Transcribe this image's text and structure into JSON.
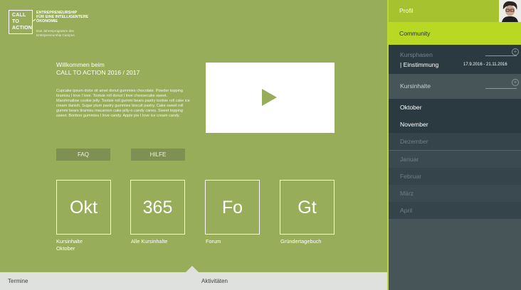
{
  "brand": {
    "logo_line1": "CALL",
    "logo_line2": "TO",
    "logo_line3": "ACTION",
    "tagline_line1": "ENTREPRENEURSHIP",
    "tagline_line2": "FÜR EINE INTELLIGENTERE",
    "tagline_line3": "ÖKONOMIE",
    "subline_line1": "Das Jahresprogramm des",
    "subline_line2": "Entrepreneurship Campus"
  },
  "main": {
    "welcome_line1": "Willkommen beim",
    "welcome_line2": "CALL TO ACTION 2016 / 2017",
    "body": "Cupcake ipsum dolor sit amet donut gummies chocolate. Powder topping tiramisu I love I love. Tootsie roll donut I love cheesecake sweet. Marshmallow cookie jelly. Tootsie roll gummi bears pastry tootsie roll cake ice cream danish. Sugar plum pastry gummies biscuit pastry. Cake sweet roll gummi bears tiramisu macaroon cake jelly-o candy canes. Sweet topping sweet. Bonbon gummies I love candy. Apple pie I love ice cream candy.",
    "faq_label": "FAQ",
    "hilfe_label": "HILFE",
    "tiles": [
      {
        "abbr": "Okt",
        "label_line1": "Kursinhalte",
        "label_line2": "Oktober"
      },
      {
        "abbr": "365",
        "label_line1": "Alle Kursinhalte",
        "label_line2": ""
      },
      {
        "abbr": "Fo",
        "label_line1": "Forum",
        "label_line2": ""
      },
      {
        "abbr": "Gt",
        "label_line1": "Gründertagebuch",
        "label_line2": ""
      }
    ]
  },
  "bottom_bar": {
    "termine": "Termine",
    "aktivitaeten": "Aktivitäten"
  },
  "sidebar": {
    "profil": "Profil",
    "community": "Community",
    "kursphasen": "Kursphasen",
    "phase": "| Einstimmung",
    "phase_dates": "17.9.2016 - 21.11.2016",
    "kursinhalte": "Kursinhalte",
    "months": [
      {
        "name": "Oktober"
      },
      {
        "name": "November"
      },
      {
        "name": "Dezember"
      },
      {
        "name": "Januar"
      },
      {
        "name": "Februar"
      },
      {
        "name": "März"
      },
      {
        "name": "April"
      }
    ]
  },
  "colors": {
    "main_bg": "#97ad5a",
    "accent_green": "#b8d824",
    "sidebar_dark": "#2b3a40",
    "sidebar_mid": "#475559"
  },
  "icons": [
    "play-icon",
    "plus-icon",
    "avatar"
  ]
}
